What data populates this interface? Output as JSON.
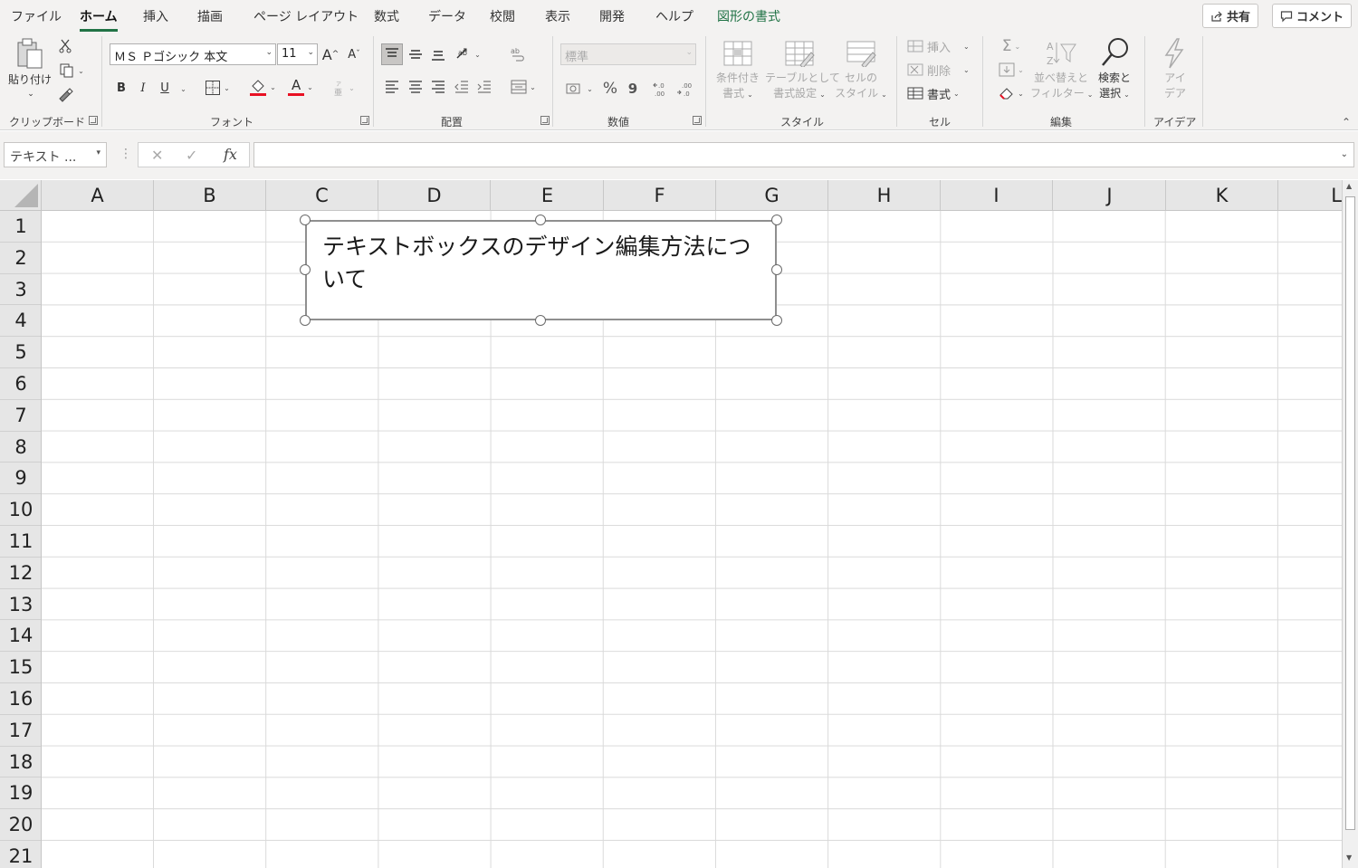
{
  "menu": {
    "tabs": [
      "ファイル",
      "ホーム",
      "挿入",
      "描画",
      "ページ レイアウト",
      "数式",
      "データ",
      "校閲",
      "表示",
      "開発",
      "ヘルプ",
      "図形の書式"
    ],
    "share_label": "共有",
    "comment_label": "コメント"
  },
  "ribbon": {
    "clipboard": {
      "paste_label": "貼り付け",
      "group_label": "クリップボード"
    },
    "font": {
      "font_name": "ＭＳ Ｐゴシック 本文",
      "font_size": "11",
      "bold": "B",
      "italic": "I",
      "underline": "U",
      "grow": "A",
      "shrink": "A",
      "font_color_letter": "A",
      "group_label": "フォント"
    },
    "alignment": {
      "group_label": "配置"
    },
    "number": {
      "format": "標準",
      "percent": "%",
      "comma": "9",
      "group_label": "数値"
    },
    "styles": {
      "conditional_line1": "条件付き",
      "conditional_line2": "書式",
      "table_line1": "テーブルとして",
      "table_line2": "書式設定",
      "cell_line1": "セルの",
      "cell_line2": "スタイル",
      "group_label": "スタイル"
    },
    "cells": {
      "insert": "挿入",
      "delete": "削除",
      "format": "書式",
      "group_label": "セル"
    },
    "editing": {
      "sum": "Σ",
      "sort_line1": "並べ替えと",
      "sort_line2": "フィルター",
      "find_line1": "検索と",
      "find_line2": "選択",
      "group_label": "編集"
    },
    "ideas": {
      "line1": "アイ",
      "line2": "デア",
      "group_label": "アイデア"
    },
    "colors": {
      "accent": "#217346",
      "font_color": "#e81123",
      "fill_color": "#e81123"
    }
  },
  "formula_bar": {
    "name_box": "テキスト ...",
    "fx": "fx",
    "value": ""
  },
  "sheet": {
    "columns": [
      "A",
      "B",
      "C",
      "D",
      "E",
      "F",
      "G",
      "H",
      "I",
      "J",
      "K",
      "L"
    ],
    "rows": [
      "1",
      "2",
      "3",
      "4",
      "5",
      "6",
      "7",
      "8",
      "9",
      "10",
      "11",
      "12",
      "13",
      "14",
      "15",
      "16",
      "17",
      "18",
      "19",
      "20",
      "21"
    ]
  },
  "textbox": {
    "text": "テキストボックスのデザイン編集方法について"
  }
}
